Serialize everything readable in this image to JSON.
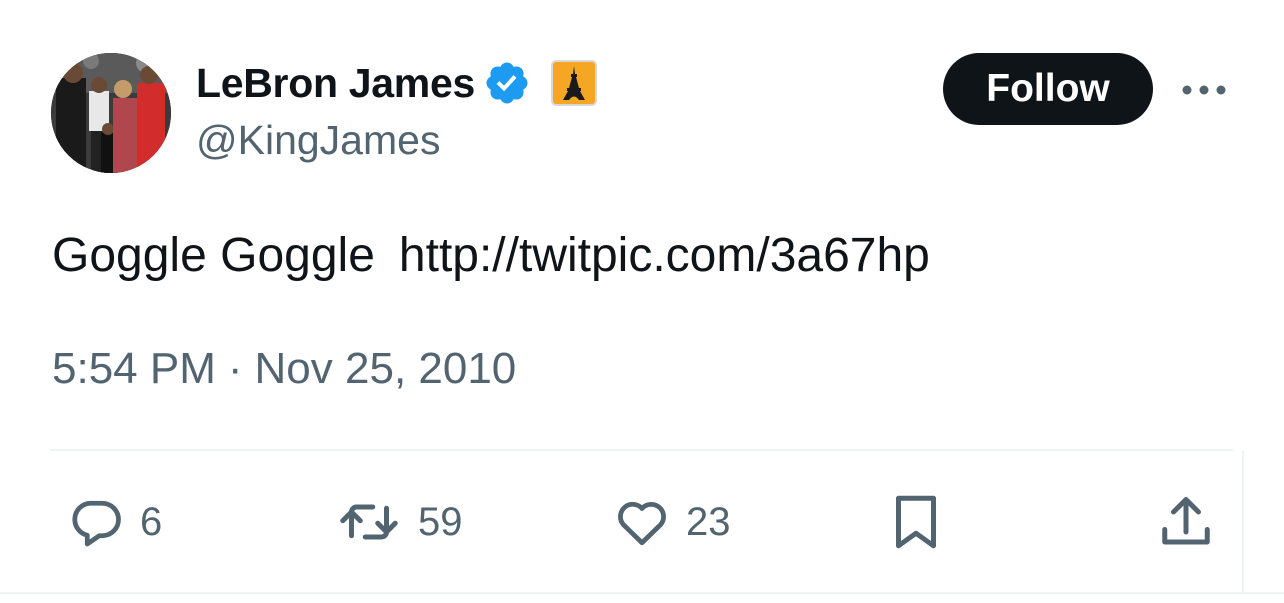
{
  "author": {
    "display_name": "LeBron James",
    "handle": "@KingJames",
    "verified_icon": "verified-badge-icon",
    "affiliate_icon": "eiffel-tower-icon",
    "verified_color": "#1d9bf0",
    "affiliate_color": "#f5a623"
  },
  "header": {
    "follow_label": "Follow",
    "more_icon": "more-dots-icon"
  },
  "tweet": {
    "text": "Goggle Goggle",
    "link": "http://twitpic.com/3a67hp"
  },
  "meta": {
    "time": "5:54 PM",
    "separator": "·",
    "date": "Nov 25, 2010"
  },
  "actions": {
    "reply_count": "6",
    "retweet_count": "59",
    "like_count": "23",
    "reply_icon": "reply-icon",
    "retweet_icon": "retweet-icon",
    "like_icon": "heart-icon",
    "bookmark_icon": "bookmark-icon",
    "share_icon": "share-icon"
  },
  "colors": {
    "text_primary": "#0f1419",
    "text_secondary": "#536471",
    "follow_bg": "#0f1419",
    "divider": "#eff3f4"
  }
}
